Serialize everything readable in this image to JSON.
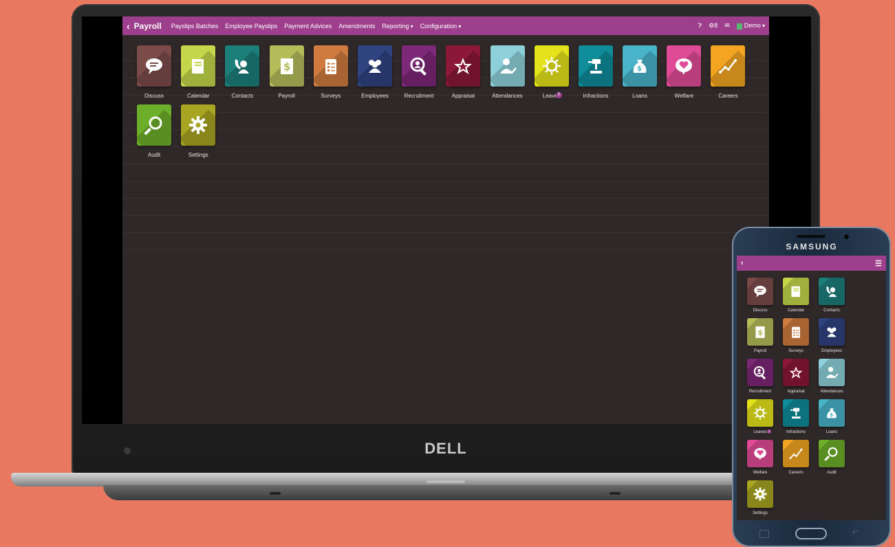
{
  "laptop": {
    "brand": "DELL",
    "topbar": {
      "back_icon": "chevron-left-icon",
      "title": "Payroll",
      "menu": [
        "Payslips Batches",
        "Employee Payslips",
        "Payment Advices",
        "Amendments",
        "Reporting",
        "Configuration"
      ],
      "help_icon": "question-icon",
      "notif_count": "8",
      "chat_icon": "chat-icon",
      "user": "Demo"
    },
    "apps": [
      {
        "label": "Discuss",
        "color": "#7b4b4a",
        "icon": "chat-bubble-icon"
      },
      {
        "label": "Calendar",
        "color": "#c4d74a",
        "icon": "book-icon"
      },
      {
        "label": "Contacts",
        "color": "#1d7f7a",
        "icon": "phone-contact-icon"
      },
      {
        "label": "Payroll",
        "color": "#b4bc5a",
        "icon": "dollar-doc-icon"
      },
      {
        "label": "Surveys",
        "color": "#cf7a3f",
        "icon": "clipboard-icon"
      },
      {
        "label": "Employees",
        "color": "#2f4380",
        "icon": "people-icon"
      },
      {
        "label": "Recruitment",
        "color": "#7d2878",
        "icon": "magnifier-person-icon"
      },
      {
        "label": "Appraisal",
        "color": "#8c1838",
        "icon": "star-icon"
      },
      {
        "label": "Attendances",
        "color": "#8ed0da",
        "icon": "person-check-icon"
      },
      {
        "label": "Leaves",
        "color": "#e4e21a",
        "icon": "sun-icon",
        "badge": "3"
      },
      {
        "label": "Infractions",
        "color": "#0f8d9a",
        "icon": "gavel-icon"
      },
      {
        "label": "Loans",
        "color": "#48b3c9",
        "icon": "money-bag-icon"
      },
      {
        "label": "Welfare",
        "color": "#e04b97",
        "icon": "heart-bubble-icon"
      },
      {
        "label": "Careers",
        "color": "#f3a521",
        "icon": "growth-chart-icon"
      },
      {
        "label": "Audit",
        "color": "#6dae2a",
        "icon": "search-icon"
      },
      {
        "label": "Settings",
        "color": "#a8a522",
        "icon": "gear-icon"
      }
    ]
  },
  "phone": {
    "brand": "SAMSUNG",
    "back_icon": "chevron-left-icon",
    "menu_icon": "hamburger-icon"
  }
}
